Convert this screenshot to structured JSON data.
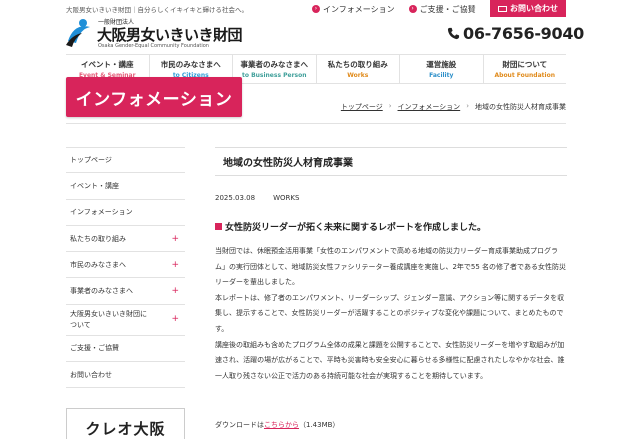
{
  "header": {
    "tagline": "大阪男女いきいき財団｜自分らしくイキイキと輝ける社会へ。",
    "logo_small": "一般財団法人",
    "logo_main": "大阪男女いきいき財団",
    "logo_en": "Osaka Gender-Equal Community Foundation",
    "top_links": [
      "インフォメーション",
      "ご支援・ご協賛"
    ],
    "contact_label": "お問い合わせ",
    "phone": "06-7656-9040"
  },
  "nav": [
    {
      "jp": "イベント・講座",
      "en": "Event & Seminar",
      "color": "#e55a78"
    },
    {
      "jp": "市民のみなさまへ",
      "en": "to Citizens",
      "color": "#2f9ed8"
    },
    {
      "jp": "事業者のみなさまへ",
      "en": "to Business Person",
      "color": "#3f9f9a"
    },
    {
      "jp": "私たちの取り組み",
      "en": "Works",
      "color": "#e08a1a"
    },
    {
      "jp": "運営施設",
      "en": "Facility",
      "color": "#2c8fc9"
    },
    {
      "jp": "財団について",
      "en": "About Foundation",
      "color": "#e08a1a"
    }
  ],
  "banner": {
    "title": "インフォメーション"
  },
  "breadcrumb": [
    "トップページ",
    "インフォメーション",
    "地域の女性防災人材育成事業"
  ],
  "sidebar": [
    {
      "label": "トップページ",
      "expandable": false
    },
    {
      "label": "イベント・講座",
      "expandable": false
    },
    {
      "label": "インフォメーション",
      "expandable": false
    },
    {
      "label": "私たちの取り組み",
      "expandable": true
    },
    {
      "label": "市民のみなさまへ",
      "expandable": true
    },
    {
      "label": "事業者のみなさまへ",
      "expandable": true
    },
    {
      "label": "大阪男女いきいき財団に\nついて",
      "expandable": true
    },
    {
      "label": "ご支援・ご協賛",
      "expandable": false
    },
    {
      "label": "お問い合わせ",
      "expandable": false
    }
  ],
  "sidebar_banner": "クレオ大阪",
  "plus_symbol": "+",
  "article": {
    "title": "地域の女性防災人材育成事業",
    "date": "2025.03.08",
    "category": "WORKS",
    "subheading": "女性防災リーダーが拓く未来に関するレポートを作成しました。",
    "paragraphs": [
      "当財団では、休眠預金活用事業「女性のエンパワメントで高める地域の防災力リーダー育成事業助成プログラム」の実行団体として、地域防災女性ファシリテーター養成講座を実施し、2年で55 名の修了者である女性防災リーダーを輩出しました。",
      "本レポートは、修了者のエンパワメント、リーダーシップ、ジェンダー意識、アクション等に関するデータを収集し、提示することで、女性防災リーダーが活躍することのポジティブな変化や課題について、まとめたものです。",
      "講座後の取組みも含めたプログラム全体の成果と課題を公開することで、女性防災リーダーを増やす取組みが加速され、活躍の場が広がることで、平時も災害時も安全安心に暮らせる多様性に配慮されたしなやかな社会、誰一人取り残さない公正で活力のある持続可能な社会が実現することを期待しています。"
    ],
    "download_prefix": "ダウンロードは",
    "download_link": "こちらから",
    "download_size": "（1.43MB）"
  },
  "colors": {
    "accent": "#d8245b",
    "logo_blue": "#1f8fd8"
  }
}
